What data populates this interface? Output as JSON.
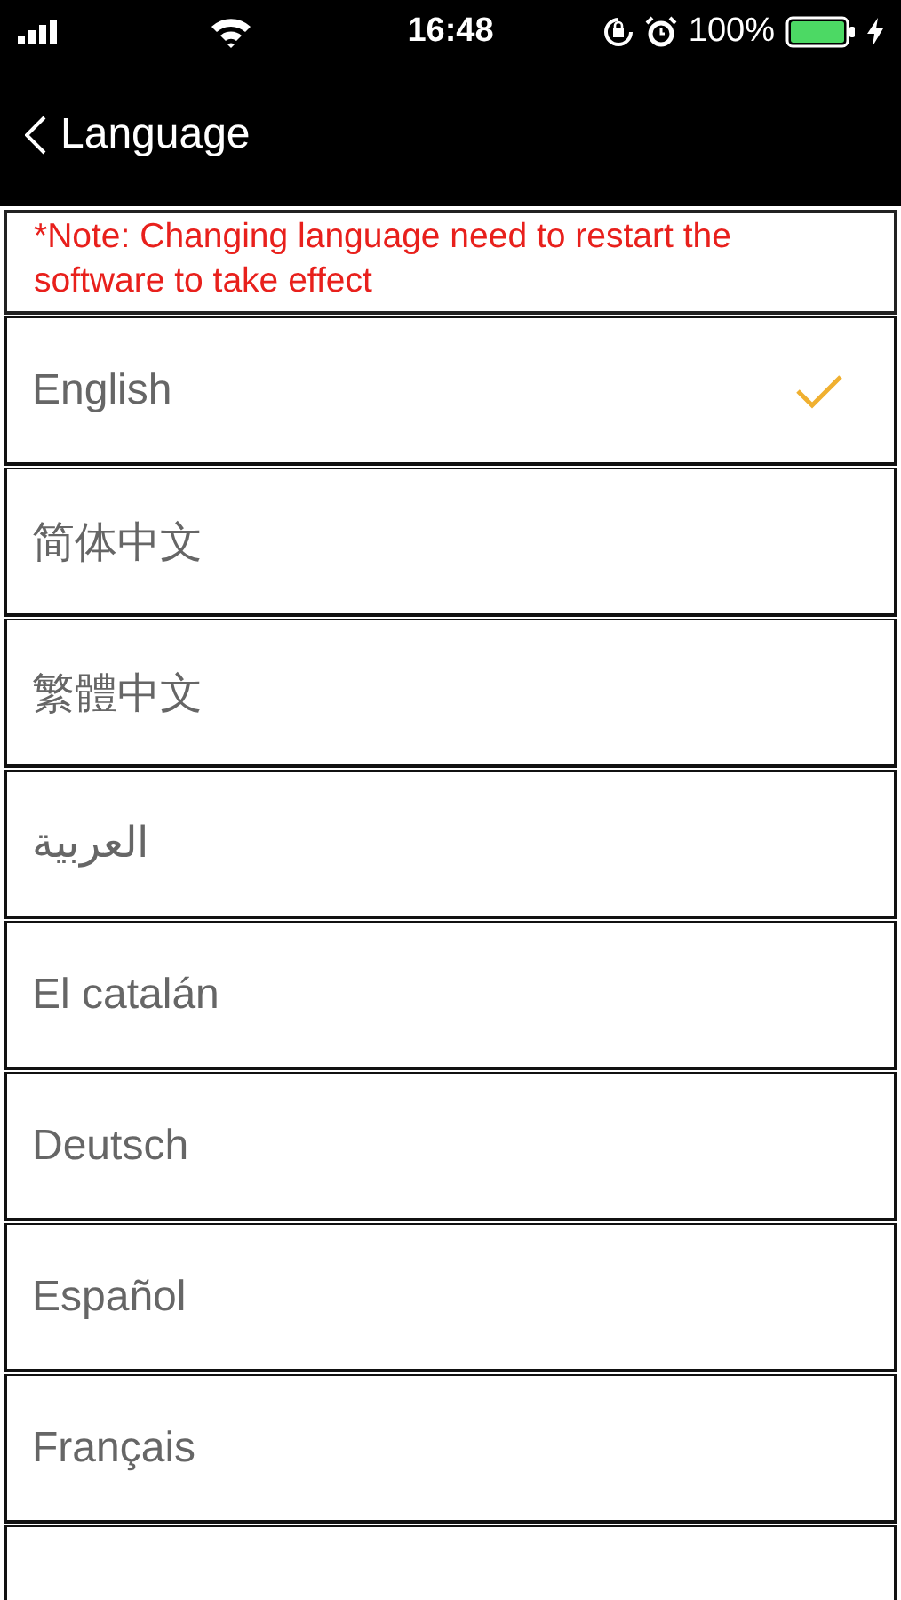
{
  "status_bar": {
    "time": "16:48",
    "battery": "100%"
  },
  "nav_bar": {
    "title": "Language"
  },
  "note": "*Note: Changing language need to restart the software to take effect",
  "languages": [
    {
      "label": "English",
      "selected": true
    },
    {
      "label": "简体中文",
      "selected": false
    },
    {
      "label": "繁體中文",
      "selected": false
    },
    {
      "label": "العربية",
      "selected": false
    },
    {
      "label": "El catalán",
      "selected": false
    },
    {
      "label": "Deutsch",
      "selected": false
    },
    {
      "label": "Español",
      "selected": false
    },
    {
      "label": "Français",
      "selected": false
    }
  ]
}
